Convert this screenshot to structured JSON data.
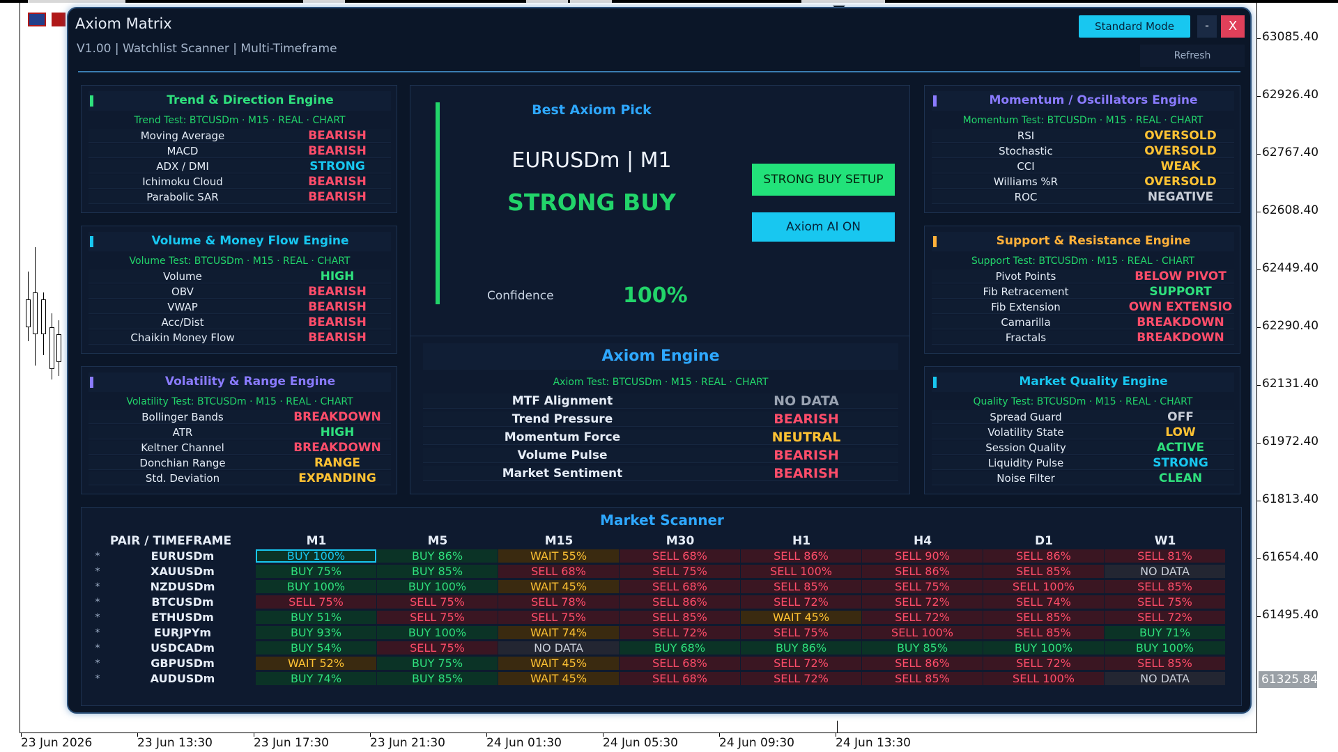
{
  "window": {
    "title": "Axiom Matrix",
    "subtitle": "V1.00 | Watchlist Scanner | Multi-Timeframe",
    "mode_button": "Standard Mode",
    "min_button": "-",
    "close_button": "X",
    "refresh_button": "Refresh"
  },
  "chart_axis": {
    "prices": [
      "63085.40",
      "62926.40",
      "62767.40",
      "62608.40",
      "62449.40",
      "62290.40",
      "62131.40",
      "61972.40",
      "61813.40",
      "61654.40",
      "61495.40"
    ],
    "current_price": "61325.84",
    "times": [
      "23 Jun 2026",
      "23 Jun 13:30",
      "23 Jun 17:30",
      "23 Jun 21:30",
      "24 Jun 01:30",
      "24 Jun 05:30",
      "24 Jun 09:30",
      "24 Jun 13:30"
    ]
  },
  "engines": {
    "trend": {
      "title": "Trend & Direction Engine",
      "color": "#2fe07d",
      "test": "Trend Test: BTCUSDm · M15 · REAL · CHART",
      "rows": [
        {
          "k": "Moving Average",
          "v": "BEARISH",
          "c": "#ff4d6a"
        },
        {
          "k": "MACD",
          "v": "BEARISH",
          "c": "#ff4d6a"
        },
        {
          "k": "ADX / DMI",
          "v": "STRONG",
          "c": "#18c7f0"
        },
        {
          "k": "Ichimoku Cloud",
          "v": "BEARISH",
          "c": "#ff4d6a"
        },
        {
          "k": "Parabolic SAR",
          "v": "BEARISH",
          "c": "#ff4d6a"
        }
      ]
    },
    "volume": {
      "title": "Volume & Money Flow Engine",
      "color": "#18c7f0",
      "test": "Volume Test: BTCUSDm · M15 · REAL · CHART",
      "rows": [
        {
          "k": "Volume",
          "v": "HIGH",
          "c": "#2fe07d"
        },
        {
          "k": "OBV",
          "v": "BEARISH",
          "c": "#ff4d6a"
        },
        {
          "k": "VWAP",
          "v": "BEARISH",
          "c": "#ff4d6a"
        },
        {
          "k": "Acc/Dist",
          "v": "BEARISH",
          "c": "#ff4d6a"
        },
        {
          "k": "Chaikin Money Flow",
          "v": "BEARISH",
          "c": "#ff4d6a"
        }
      ]
    },
    "volatility": {
      "title": "Volatility & Range Engine",
      "color": "#8a7bff",
      "test": "Volatility Test: BTCUSDm · M15 · REAL · CHART",
      "rows": [
        {
          "k": "Bollinger Bands",
          "v": "BREAKDOWN",
          "c": "#ff4d6a"
        },
        {
          "k": "ATR",
          "v": "HIGH",
          "c": "#2fe07d"
        },
        {
          "k": "Keltner Channel",
          "v": "BREAKDOWN",
          "c": "#ff4d6a"
        },
        {
          "k": "Donchian Range",
          "v": "RANGE",
          "c": "#ffc233"
        },
        {
          "k": "Std. Deviation",
          "v": "EXPANDING",
          "c": "#ffc233"
        }
      ]
    },
    "momentum": {
      "title": "Momentum / Oscillators Engine",
      "color": "#8a7bff",
      "test": "Momentum Test: BTCUSDm · M15 · REAL · CHART",
      "rows": [
        {
          "k": "RSI",
          "v": "OVERSOLD",
          "c": "#ffc233"
        },
        {
          "k": "Stochastic",
          "v": "OVERSOLD",
          "c": "#ffc233"
        },
        {
          "k": "CCI",
          "v": "WEAK",
          "c": "#ffc233"
        },
        {
          "k": "Williams %R",
          "v": "OVERSOLD",
          "c": "#ffc233"
        },
        {
          "k": "ROC",
          "v": "NEGATIVE",
          "c": "#c9ced8"
        }
      ]
    },
    "support": {
      "title": "Support & Resistance Engine",
      "color": "#ffb13a",
      "test": "Support Test: BTCUSDm · M15 · REAL · CHART",
      "rows": [
        {
          "k": "Pivot Points",
          "v": "BELOW PIVOT",
          "c": "#ff4d6a"
        },
        {
          "k": "Fib Retracement",
          "v": "SUPPORT",
          "c": "#2fe07d"
        },
        {
          "k": "Fib Extension",
          "v": "OWN EXTENSIO",
          "c": "#ff4d6a"
        },
        {
          "k": "Camarilla",
          "v": "BREAKDOWN",
          "c": "#ff4d6a"
        },
        {
          "k": "Fractals",
          "v": "BREAKDOWN",
          "c": "#ff4d6a"
        }
      ]
    },
    "quality": {
      "title": "Market Quality Engine",
      "color": "#18c7f0",
      "test": "Quality Test: BTCUSDm · M15 · REAL · CHART",
      "rows": [
        {
          "k": "Spread Guard",
          "v": "OFF",
          "c": "#c9ced8"
        },
        {
          "k": "Volatility State",
          "v": "LOW",
          "c": "#ffc233"
        },
        {
          "k": "Session Quality",
          "v": "ACTIVE",
          "c": "#2fe07d"
        },
        {
          "k": "Liquidity Pulse",
          "v": "STRONG",
          "c": "#18c7f0"
        },
        {
          "k": "Noise Filter",
          "v": "CLEAN",
          "c": "#2fe07d"
        }
      ]
    }
  },
  "best_pick": {
    "title": "Best Axiom Pick",
    "pair": "EURUSDm | M1",
    "signal": "STRONG BUY",
    "confidence_label": "Confidence",
    "confidence_value": "100%",
    "setup_button": "STRONG BUY SETUP",
    "ai_button": "Axiom AI ON"
  },
  "axiom_engine": {
    "title": "Axiom Engine",
    "test": "Axiom Test: BTCUSDm · M15 · REAL · CHART",
    "rows": [
      {
        "k": "MTF Alignment",
        "v": "NO DATA",
        "c": "#9aa3b2"
      },
      {
        "k": "Trend Pressure",
        "v": "BEARISH",
        "c": "#ff4d6a"
      },
      {
        "k": "Momentum Force",
        "v": "NEUTRAL",
        "c": "#ffc233"
      },
      {
        "k": "Volume Pulse",
        "v": "BEARISH",
        "c": "#ff4d6a"
      },
      {
        "k": "Market Sentiment",
        "v": "BEARISH",
        "c": "#ff4d6a"
      }
    ]
  },
  "scanner": {
    "title": "Market Scanner",
    "header": [
      "PAIR / TIMEFRAME",
      "M1",
      "M5",
      "M15",
      "M30",
      "H1",
      "H4",
      "D1",
      "W1"
    ],
    "rows": [
      {
        "star": "*",
        "pair": "EURUSDm",
        "cells": [
          "BUY 100%",
          "BUY 86%",
          "WAIT 55%",
          "SELL 68%",
          "SELL 86%",
          "SELL 90%",
          "SELL 86%",
          "SELL 81%"
        ]
      },
      {
        "star": "*",
        "pair": "XAUUSDm",
        "cells": [
          "BUY 75%",
          "BUY 85%",
          "SELL 68%",
          "SELL 75%",
          "SELL 100%",
          "SELL 86%",
          "SELL 85%",
          "NO DATA"
        ]
      },
      {
        "star": "*",
        "pair": "NZDUSDm",
        "cells": [
          "BUY 100%",
          "BUY 100%",
          "WAIT 45%",
          "SELL 68%",
          "SELL 85%",
          "SELL 75%",
          "SELL 100%",
          "SELL 85%"
        ]
      },
      {
        "star": "*",
        "pair": "BTCUSDm",
        "cells": [
          "SELL 75%",
          "SELL 75%",
          "SELL 78%",
          "SELL 86%",
          "SELL 72%",
          "SELL 72%",
          "SELL 74%",
          "SELL 75%"
        ]
      },
      {
        "star": "*",
        "pair": "ETHUSDm",
        "cells": [
          "BUY 51%",
          "SELL 75%",
          "SELL 75%",
          "SELL 85%",
          "WAIT 45%",
          "SELL 72%",
          "SELL 85%",
          "SELL 72%"
        ]
      },
      {
        "star": "*",
        "pair": "EURJPYm",
        "cells": [
          "BUY 93%",
          "BUY 100%",
          "WAIT 74%",
          "SELL 72%",
          "SELL 75%",
          "SELL 100%",
          "SELL 85%",
          "BUY 71%"
        ]
      },
      {
        "star": "*",
        "pair": "USDCADm",
        "cells": [
          "BUY 54%",
          "SELL 75%",
          "NO DATA",
          "BUY 68%",
          "BUY 86%",
          "BUY 85%",
          "BUY 100%",
          "BUY 100%"
        ]
      },
      {
        "star": "*",
        "pair": "GBPUSDm",
        "cells": [
          "WAIT 52%",
          "BUY 75%",
          "WAIT 45%",
          "SELL 68%",
          "SELL 72%",
          "SELL 86%",
          "SELL 72%",
          "SELL 85%"
        ]
      },
      {
        "star": "*",
        "pair": "AUDUSDm",
        "cells": [
          "BUY 74%",
          "BUY 85%",
          "WAIT 45%",
          "SELL 68%",
          "SELL 72%",
          "SELL 85%",
          "SELL 100%",
          "NO DATA"
        ]
      }
    ]
  }
}
